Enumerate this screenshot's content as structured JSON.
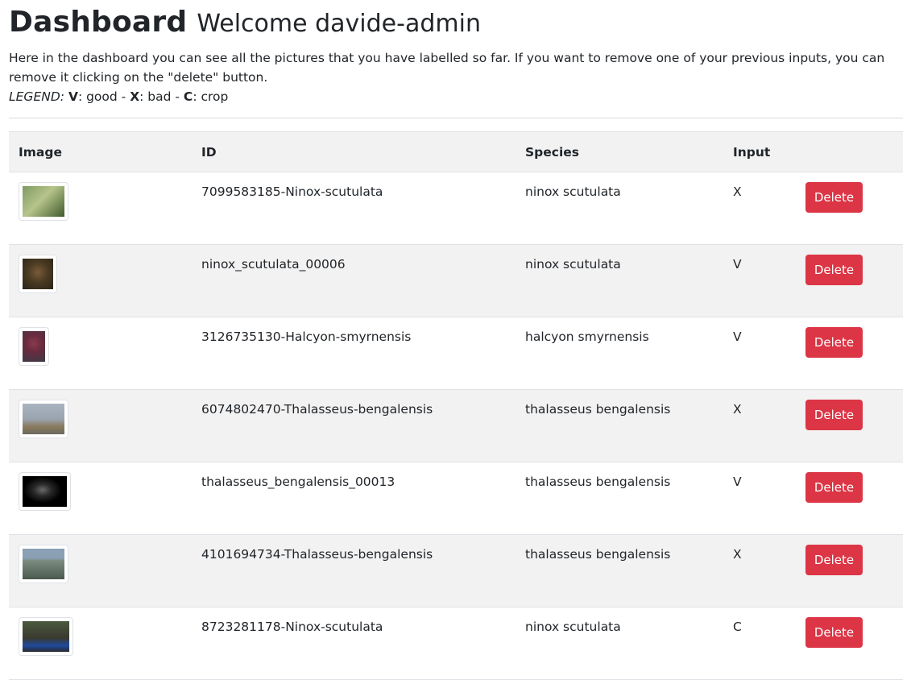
{
  "header": {
    "title": "Dashboard",
    "subtitle": "Welcome davide-admin",
    "intro": "Here in the dashboard you can see all the pictures that you have labelled so far. If you want to remove one of your previous inputs, you can remove it clicking on the \"delete\" button.",
    "legend": {
      "label": "LEGEND:",
      "v_key": "V",
      "v_text": ": good - ",
      "x_key": "X",
      "x_text": ": bad - ",
      "c_key": "C",
      "c_text": ": crop"
    }
  },
  "table": {
    "columns": {
      "image": "Image",
      "id": "ID",
      "species": "Species",
      "input": "Input"
    },
    "delete_label": "Delete",
    "rows": [
      {
        "id": "7099583185-Ninox-scutulata",
        "species": "ninox scutulata",
        "input": "X",
        "thumb_colors": [
          "#7f9a63",
          "#3f5a2e"
        ]
      },
      {
        "id": "ninox_scutulata_00006",
        "species": "ninox scutulata",
        "input": "V",
        "thumb_colors": [
          "#7a5a3a",
          "#2a2418"
        ]
      },
      {
        "id": "3126735130-Halcyon-smyrnensis",
        "species": "halcyon smyrnensis",
        "input": "V",
        "thumb_colors": [
          "#6a2a3e",
          "#3a3a46"
        ]
      },
      {
        "id": "6074802470-Thalasseus-bengalensis",
        "species": "thalasseus bengalensis",
        "input": "X",
        "thumb_colors": [
          "#9aa4b0",
          "#6a6a5e"
        ]
      },
      {
        "id": "thalasseus_bengalensis_00013",
        "species": "thalasseus bengalensis",
        "input": "V",
        "thumb_colors": [
          "#000000",
          "#2a2a2a"
        ]
      },
      {
        "id": "4101694734-Thalasseus-bengalensis",
        "species": "thalasseus bengalensis",
        "input": "X",
        "thumb_colors": [
          "#8aa0b4",
          "#4a5a4e"
        ]
      },
      {
        "id": "8723281178-Ninox-scutulata",
        "species": "ninox scutulata",
        "input": "C",
        "thumb_colors": [
          "#4a5a3e",
          "#1e4aa0"
        ]
      }
    ]
  }
}
